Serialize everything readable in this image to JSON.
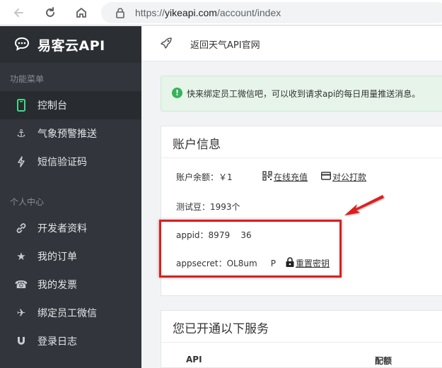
{
  "browser": {
    "url_scheme": "https://",
    "url_host": "yikeapi.com",
    "url_path": "/account/index"
  },
  "sidebar": {
    "logo_text": "易客云API",
    "section1_title": "功能菜单",
    "section2_title": "个人中心",
    "items": [
      {
        "label": "控制台",
        "icon": "phone-icon"
      },
      {
        "label": "气象预警推送",
        "icon": "anchor-icon"
      },
      {
        "label": "短信验证码",
        "icon": "bolt-icon"
      },
      {
        "label": "开发者资料",
        "icon": "link-icon"
      },
      {
        "label": "我的订单",
        "icon": "star-icon"
      },
      {
        "label": "我的发票",
        "icon": "telephone-icon"
      },
      {
        "label": "绑定员工微信",
        "icon": "plane-icon"
      },
      {
        "label": "登录日志",
        "icon": "magnet-icon"
      }
    ]
  },
  "header": {
    "back_link": "返回天气API官网"
  },
  "alert": {
    "text": "快来绑定员工微信吧，可以收到请求api的每日用量推送消息。"
  },
  "account": {
    "title": "账户信息",
    "balance_label": "账户余额：",
    "balance_value": "￥1",
    "recharge_link": "在线充值",
    "transfer_link": "对公打款",
    "beans_label": "测试豆：",
    "beans_value": "1993个",
    "appid_label": "appid：",
    "appid_value": "8979    36",
    "appsecret_label": "appsecret：",
    "appsecret_value": "OL8um     P",
    "reset_link": "重置密钥"
  },
  "services": {
    "title": "您已开通以下服务",
    "col_api": "API",
    "col_quota": "配额"
  },
  "colors": {
    "sidebar_bg": "#32353b",
    "active_icon": "#3ddc84",
    "highlight_box": "#e11b1b"
  }
}
